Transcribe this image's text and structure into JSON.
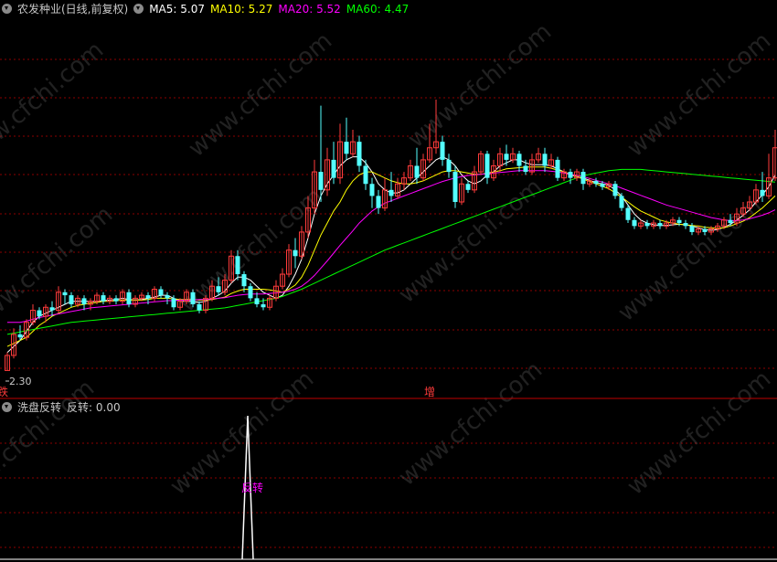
{
  "price_header": {
    "title": "农发种业(日线,前复权)",
    "ma5_label": "MA5: 5.07",
    "ma10_label": "MA10: 5.27",
    "ma20_label": "MA20: 5.52",
    "ma60_label": "MA60: 4.47"
  },
  "indicator_header": {
    "title": "洗盘反转",
    "value_label": "反转: 0.00"
  },
  "colors": {
    "up": "#ff3b3b",
    "down": "#54ffff",
    "ma5": "#ffffff",
    "ma10": "#ffff00",
    "ma20": "#ff00ff",
    "ma60": "#00ff00",
    "grid": "#8b0000",
    "signal": "#ffffff",
    "signal_label": "#ff00ff"
  },
  "watermark": "www.cfchi.com",
  "chart_data": [
    {
      "type": "candlestick",
      "title": "农发种业(日线,前复权)",
      "low_label": "2.30",
      "left_marker": "跌",
      "mid_marker": "增",
      "ylim": [
        2.2,
        8.0
      ],
      "candles": [
        [
          2.3,
          2.55,
          2.3,
          2.6
        ],
        [
          2.55,
          2.9,
          2.5,
          3.0
        ],
        [
          2.9,
          2.85,
          2.8,
          3.05
        ],
        [
          2.85,
          3.1,
          2.8,
          3.15
        ],
        [
          3.1,
          3.3,
          3.05,
          3.4
        ],
        [
          3.3,
          3.2,
          3.15,
          3.35
        ],
        [
          3.2,
          3.35,
          3.1,
          3.4
        ],
        [
          3.35,
          3.3,
          3.2,
          3.45
        ],
        [
          3.3,
          3.6,
          3.25,
          3.7
        ],
        [
          3.6,
          3.55,
          3.4,
          3.65
        ],
        [
          3.55,
          3.4,
          3.35,
          3.6
        ],
        [
          3.4,
          3.5,
          3.35,
          3.55
        ],
        [
          3.5,
          3.4,
          3.3,
          3.55
        ],
        [
          3.4,
          3.45,
          3.3,
          3.5
        ],
        [
          3.45,
          3.55,
          3.4,
          3.6
        ],
        [
          3.55,
          3.45,
          3.4,
          3.6
        ],
        [
          3.45,
          3.5,
          3.4,
          3.55
        ],
        [
          3.5,
          3.45,
          3.4,
          3.55
        ],
        [
          3.45,
          3.6,
          3.4,
          3.65
        ],
        [
          3.6,
          3.4,
          3.35,
          3.65
        ],
        [
          3.4,
          3.5,
          3.35,
          3.55
        ],
        [
          3.5,
          3.55,
          3.45,
          3.6
        ],
        [
          3.55,
          3.5,
          3.4,
          3.6
        ],
        [
          3.5,
          3.65,
          3.45,
          3.7
        ],
        [
          3.65,
          3.55,
          3.5,
          3.7
        ],
        [
          3.55,
          3.5,
          3.4,
          3.6
        ],
        [
          3.5,
          3.35,
          3.3,
          3.55
        ],
        [
          3.35,
          3.45,
          3.3,
          3.5
        ],
        [
          3.45,
          3.6,
          3.4,
          3.65
        ],
        [
          3.6,
          3.4,
          3.35,
          3.65
        ],
        [
          3.4,
          3.3,
          3.25,
          3.45
        ],
        [
          3.3,
          3.5,
          3.25,
          3.55
        ],
        [
          3.5,
          3.7,
          3.45,
          3.8
        ],
        [
          3.7,
          3.6,
          3.55,
          3.85
        ],
        [
          3.6,
          3.8,
          3.55,
          3.9
        ],
        [
          3.8,
          4.2,
          3.75,
          4.3
        ],
        [
          4.2,
          3.9,
          3.8,
          4.3
        ],
        [
          3.9,
          3.7,
          3.6,
          3.95
        ],
        [
          3.7,
          3.5,
          3.45,
          3.75
        ],
        [
          3.5,
          3.4,
          3.35,
          3.6
        ],
        [
          3.4,
          3.35,
          3.3,
          3.5
        ],
        [
          3.35,
          3.5,
          3.3,
          3.55
        ],
        [
          3.5,
          3.7,
          3.45,
          3.8
        ],
        [
          3.7,
          3.9,
          3.65,
          4.0
        ],
        [
          3.9,
          4.3,
          3.85,
          4.4
        ],
        [
          4.3,
          4.2,
          4.0,
          4.5
        ],
        [
          4.2,
          4.6,
          4.15,
          4.7
        ],
        [
          4.6,
          5.0,
          4.5,
          5.2
        ],
        [
          5.0,
          5.6,
          4.9,
          5.8
        ],
        [
          5.6,
          5.3,
          5.1,
          6.7
        ],
        [
          5.3,
          5.8,
          5.2,
          6.0
        ],
        [
          5.8,
          5.5,
          5.4,
          6.1
        ],
        [
          5.5,
          6.1,
          5.4,
          6.4
        ],
        [
          6.1,
          5.9,
          5.8,
          6.5
        ],
        [
          5.9,
          6.1,
          5.85,
          6.3
        ],
        [
          6.1,
          5.7,
          5.6,
          6.2
        ],
        [
          5.7,
          5.4,
          5.3,
          5.8
        ],
        [
          5.4,
          5.2,
          5.0,
          5.5
        ],
        [
          5.2,
          5.0,
          4.9,
          5.3
        ],
        [
          5.0,
          5.3,
          4.95,
          5.5
        ],
        [
          5.3,
          5.2,
          5.1,
          5.6
        ],
        [
          5.2,
          5.4,
          5.15,
          5.5
        ],
        [
          5.4,
          5.5,
          5.3,
          5.6
        ],
        [
          5.5,
          5.7,
          5.45,
          5.8
        ],
        [
          5.7,
          5.5,
          5.4,
          6.0
        ],
        [
          5.5,
          5.8,
          5.45,
          5.9
        ],
        [
          5.8,
          6.0,
          5.75,
          6.4
        ],
        [
          6.0,
          6.1,
          5.9,
          6.8
        ],
        [
          6.1,
          5.8,
          5.7,
          6.2
        ],
        [
          5.8,
          5.6,
          5.5,
          5.9
        ],
        [
          5.6,
          5.1,
          5.0,
          5.7
        ],
        [
          5.1,
          5.4,
          5.05,
          5.5
        ],
        [
          5.4,
          5.3,
          5.25,
          5.45
        ],
        [
          5.3,
          5.6,
          5.25,
          5.7
        ],
        [
          5.6,
          5.9,
          5.55,
          5.95
        ],
        [
          5.9,
          5.5,
          5.4,
          5.95
        ],
        [
          5.5,
          5.7,
          5.45,
          5.8
        ],
        [
          5.7,
          5.9,
          5.6,
          6.0
        ],
        [
          5.9,
          5.8,
          5.7,
          6.05
        ],
        [
          5.8,
          5.9,
          5.75,
          6.0
        ],
        [
          5.9,
          5.7,
          5.6,
          5.95
        ],
        [
          5.7,
          5.6,
          5.55,
          5.8
        ],
        [
          5.6,
          5.8,
          5.55,
          5.9
        ],
        [
          5.8,
          5.9,
          5.75,
          6.0
        ],
        [
          5.9,
          5.7,
          5.6,
          6.0
        ],
        [
          5.7,
          5.8,
          5.65,
          5.9
        ],
        [
          5.8,
          5.5,
          5.45,
          5.85
        ],
        [
          5.5,
          5.6,
          5.45,
          5.65
        ],
        [
          5.6,
          5.5,
          5.4,
          5.65
        ],
        [
          5.5,
          5.6,
          5.45,
          5.65
        ],
        [
          5.6,
          5.4,
          5.3,
          5.65
        ],
        [
          5.4,
          5.45,
          5.35,
          5.5
        ],
        [
          5.45,
          5.4,
          5.35,
          5.5
        ],
        [
          5.4,
          5.35,
          5.3,
          5.45
        ],
        [
          5.35,
          5.4,
          5.3,
          5.45
        ],
        [
          5.4,
          5.2,
          5.15,
          5.45
        ],
        [
          5.2,
          5.0,
          4.95,
          5.25
        ],
        [
          5.0,
          4.8,
          4.75,
          5.05
        ],
        [
          4.8,
          4.7,
          4.65,
          4.85
        ],
        [
          4.7,
          4.75,
          4.65,
          4.8
        ],
        [
          4.75,
          4.7,
          4.65,
          4.8
        ],
        [
          4.7,
          4.75,
          4.65,
          4.8
        ],
        [
          4.75,
          4.7,
          4.65,
          4.8
        ],
        [
          4.7,
          4.75,
          4.65,
          4.8
        ],
        [
          4.75,
          4.8,
          4.7,
          4.85
        ],
        [
          4.8,
          4.75,
          4.7,
          4.85
        ],
        [
          4.75,
          4.7,
          4.65,
          4.8
        ],
        [
          4.7,
          4.6,
          4.55,
          4.75
        ],
        [
          4.6,
          4.65,
          4.55,
          4.7
        ],
        [
          4.65,
          4.6,
          4.55,
          4.7
        ],
        [
          4.6,
          4.65,
          4.55,
          4.7
        ],
        [
          4.65,
          4.7,
          4.6,
          4.75
        ],
        [
          4.7,
          4.8,
          4.65,
          4.85
        ],
        [
          4.8,
          4.75,
          4.7,
          4.9
        ],
        [
          4.75,
          4.9,
          4.7,
          5.0
        ],
        [
          4.9,
          5.0,
          4.85,
          5.1
        ],
        [
          5.0,
          5.1,
          4.95,
          5.2
        ],
        [
          5.1,
          5.3,
          5.05,
          5.4
        ],
        [
          5.3,
          5.2,
          5.1,
          5.6
        ],
        [
          5.2,
          5.5,
          5.15,
          5.9
        ],
        [
          5.5,
          6.0,
          5.45,
          6.3
        ]
      ],
      "series": [
        {
          "name": "MA5",
          "values": [
            2.6,
            2.7,
            2.8,
            2.95,
            3.1,
            3.2,
            3.25,
            3.3,
            3.35,
            3.4,
            3.45,
            3.45,
            3.45,
            3.45,
            3.45,
            3.46,
            3.47,
            3.48,
            3.5,
            3.48,
            3.47,
            3.48,
            3.5,
            3.52,
            3.55,
            3.55,
            3.5,
            3.45,
            3.45,
            3.45,
            3.43,
            3.45,
            3.5,
            3.55,
            3.62,
            3.75,
            3.85,
            3.85,
            3.8,
            3.7,
            3.6,
            3.55,
            3.5,
            3.55,
            3.7,
            3.9,
            4.15,
            4.5,
            4.9,
            5.2,
            5.4,
            5.55,
            5.7,
            5.8,
            5.85,
            5.85,
            5.75,
            5.6,
            5.4,
            5.3,
            5.25,
            5.25,
            5.3,
            5.4,
            5.5,
            5.6,
            5.7,
            5.8,
            5.85,
            5.8,
            5.7,
            5.55,
            5.45,
            5.4,
            5.45,
            5.55,
            5.6,
            5.7,
            5.75,
            5.8,
            5.8,
            5.75,
            5.72,
            5.72,
            5.72,
            5.7,
            5.65,
            5.6,
            5.55,
            5.52,
            5.5,
            5.46,
            5.42,
            5.4,
            5.38,
            5.3,
            5.2,
            5.05,
            4.9,
            4.8,
            4.75,
            4.72,
            4.71,
            4.71,
            4.72,
            4.73,
            4.72,
            4.7,
            4.67,
            4.64,
            4.63,
            4.64,
            4.68,
            4.73,
            4.8,
            4.88,
            4.97,
            5.1,
            5.22,
            5.35,
            5.55
          ]
        },
        {
          "name": "MA10",
          "values": [
            2.7,
            2.75,
            2.8,
            2.85,
            2.95,
            3.05,
            3.12,
            3.2,
            3.25,
            3.3,
            3.35,
            3.38,
            3.4,
            3.42,
            3.43,
            3.45,
            3.45,
            3.46,
            3.47,
            3.47,
            3.47,
            3.47,
            3.48,
            3.5,
            3.5,
            3.5,
            3.49,
            3.48,
            3.48,
            3.48,
            3.47,
            3.47,
            3.48,
            3.5,
            3.52,
            3.58,
            3.62,
            3.65,
            3.65,
            3.65,
            3.65,
            3.64,
            3.62,
            3.6,
            3.65,
            3.72,
            3.85,
            4.05,
            4.3,
            4.55,
            4.75,
            4.95,
            5.1,
            5.3,
            5.45,
            5.55,
            5.6,
            5.6,
            5.55,
            5.5,
            5.45,
            5.42,
            5.4,
            5.4,
            5.42,
            5.45,
            5.5,
            5.55,
            5.6,
            5.62,
            5.62,
            5.6,
            5.58,
            5.56,
            5.56,
            5.58,
            5.6,
            5.62,
            5.65,
            5.66,
            5.67,
            5.68,
            5.68,
            5.68,
            5.68,
            5.66,
            5.63,
            5.6,
            5.56,
            5.52,
            5.48,
            5.44,
            5.4,
            5.36,
            5.32,
            5.25,
            5.18,
            5.1,
            5.02,
            4.95,
            4.9,
            4.85,
            4.8,
            4.77,
            4.75,
            4.73,
            4.72,
            4.71,
            4.7,
            4.68,
            4.67,
            4.66,
            4.67,
            4.7,
            4.74,
            4.78,
            4.84,
            4.92,
            5.0,
            5.1,
            5.2
          ]
        },
        {
          "name": "MA20",
          "values": [
            3.1,
            3.1,
            3.1,
            3.12,
            3.15,
            3.18,
            3.2,
            3.22,
            3.24,
            3.26,
            3.28,
            3.3,
            3.32,
            3.34,
            3.35,
            3.36,
            3.37,
            3.38,
            3.39,
            3.4,
            3.41,
            3.42,
            3.43,
            3.44,
            3.45,
            3.46,
            3.46,
            3.47,
            3.47,
            3.47,
            3.48,
            3.48,
            3.49,
            3.5,
            3.51,
            3.53,
            3.55,
            3.56,
            3.57,
            3.57,
            3.57,
            3.58,
            3.59,
            3.6,
            3.62,
            3.65,
            3.7,
            3.78,
            3.88,
            4.0,
            4.12,
            4.25,
            4.38,
            4.5,
            4.62,
            4.75,
            4.85,
            4.95,
            5.02,
            5.08,
            5.12,
            5.16,
            5.2,
            5.24,
            5.28,
            5.32,
            5.36,
            5.4,
            5.44,
            5.47,
            5.5,
            5.52,
            5.54,
            5.55,
            5.56,
            5.57,
            5.58,
            5.59,
            5.6,
            5.61,
            5.62,
            5.62,
            5.62,
            5.62,
            5.62,
            5.61,
            5.6,
            5.58,
            5.56,
            5.54,
            5.52,
            5.49,
            5.46,
            5.43,
            5.4,
            5.37,
            5.33,
            5.29,
            5.25,
            5.21,
            5.17,
            5.13,
            5.09,
            5.05,
            5.02,
            4.99,
            4.96,
            4.93,
            4.9,
            4.87,
            4.84,
            4.82,
            4.8,
            4.79,
            4.79,
            4.8,
            4.82,
            4.85,
            4.88,
            4.92,
            4.97
          ]
        },
        {
          "name": "MA60",
          "values": [
            2.9,
            2.92,
            2.94,
            2.96,
            2.98,
            3.0,
            3.02,
            3.04,
            3.06,
            3.08,
            3.1,
            3.11,
            3.12,
            3.13,
            3.14,
            3.15,
            3.16,
            3.17,
            3.18,
            3.19,
            3.2,
            3.21,
            3.22,
            3.23,
            3.24,
            3.25,
            3.26,
            3.27,
            3.28,
            3.29,
            3.3,
            3.31,
            3.32,
            3.33,
            3.34,
            3.36,
            3.38,
            3.4,
            3.42,
            3.44,
            3.46,
            3.48,
            3.5,
            3.53,
            3.57,
            3.61,
            3.65,
            3.7,
            3.75,
            3.8,
            3.85,
            3.9,
            3.95,
            4.0,
            4.05,
            4.1,
            4.15,
            4.2,
            4.25,
            4.3,
            4.34,
            4.38,
            4.42,
            4.46,
            4.5,
            4.54,
            4.58,
            4.62,
            4.66,
            4.7,
            4.74,
            4.78,
            4.82,
            4.86,
            4.9,
            4.94,
            4.98,
            5.02,
            5.06,
            5.1,
            5.14,
            5.18,
            5.22,
            5.26,
            5.3,
            5.34,
            5.38,
            5.42,
            5.46,
            5.5,
            5.53,
            5.56,
            5.58,
            5.6,
            5.62,
            5.63,
            5.64,
            5.64,
            5.64,
            5.64,
            5.63,
            5.62,
            5.61,
            5.6,
            5.59,
            5.58,
            5.57,
            5.56,
            5.55,
            5.54,
            5.53,
            5.52,
            5.51,
            5.5,
            5.49,
            5.48,
            5.47,
            5.46,
            5.45,
            5.44,
            5.43
          ]
        }
      ]
    },
    {
      "type": "line",
      "title": "洗盘反转",
      "signal_label": "反转",
      "series": [
        {
          "name": "反转",
          "peak_index": 49,
          "peak_value": 1.0
        }
      ]
    }
  ]
}
